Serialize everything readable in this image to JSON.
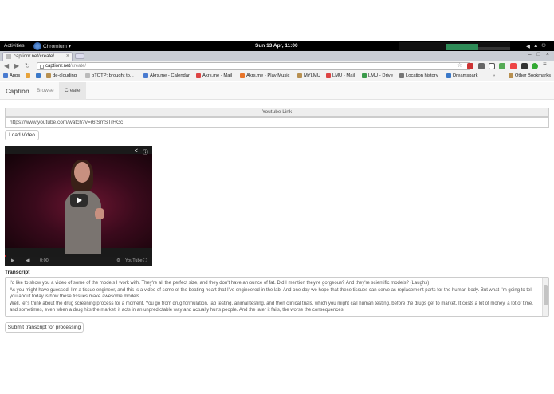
{
  "gnome": {
    "activities": "Activities",
    "app_name": "Chromium ▾",
    "clock": "Sun 13 Apr, 11:00",
    "tray_icons": [
      "volume-icon",
      "network-icon",
      "power-icon"
    ]
  },
  "browser": {
    "tab_title": "captionr.net/create/",
    "url_host": "captionr.net",
    "url_path": "/create/",
    "bookmarks": [
      {
        "label": "Apps",
        "icon": "apps-grid-icon",
        "color": "#4a7bd0"
      },
      {
        "label": "",
        "icon": "bookmark-icon",
        "color": "#e8a33a"
      },
      {
        "label": "",
        "icon": "diamond-icon",
        "color": "#3a78c8"
      },
      {
        "label": "de-clouding",
        "icon": "folder-icon",
        "color": "#b89050"
      },
      {
        "label": "pTOTP: brought to...",
        "icon": "page-icon",
        "color": "#bbbbbb"
      },
      {
        "label": "Akrs.me - Calendar",
        "icon": "calendar-icon",
        "color": "#4a7bd0"
      },
      {
        "label": "Akrs.me - Mail",
        "icon": "mail-icon",
        "color": "#d44"
      },
      {
        "label": "Akrs.me - Play Music",
        "icon": "play-music-icon",
        "color": "#e8752a"
      },
      {
        "label": "MYLMU",
        "icon": "folder-icon",
        "color": "#b89050"
      },
      {
        "label": "LMU - Mail",
        "icon": "gmail-icon",
        "color": "#d44"
      },
      {
        "label": "LMU - Drive",
        "icon": "drive-icon",
        "color": "#3a9a4a"
      },
      {
        "label": "Location history",
        "icon": "location-icon",
        "color": "#777"
      },
      {
        "label": "Dreamspark",
        "icon": "dreamspark-icon",
        "color": "#3a78c8"
      }
    ],
    "other_bookmarks": "Other Bookmarks"
  },
  "navbar": {
    "brand": "Caption",
    "links": [
      "Browse",
      "Create"
    ],
    "active": "Create"
  },
  "form": {
    "youtube_label": "Youtube Link",
    "youtube_value": "https://www.youtube.com/watch?v=r6tSmSTrHGc",
    "load_button": "Load Video"
  },
  "video": {
    "time": "0:00",
    "progress_fraction": 0.0,
    "logo": "YouTube"
  },
  "transcript": {
    "label": "Transcript",
    "lines": [
      "I'd like to show you a video of some of the models I work with. They're all the perfect size, and they don't have an ounce of fat. Did I mention they're gorgeous? And they're scientific models? (Laughs)",
      "As you might have guessed, I'm a tissue engineer, and this is a video of some of the beating heart that I've engineered in the lab. And one day we hope that these tissues can serve as replacement parts for the human body. But what I'm going to tell you about today is how these tissues make awesome models.",
      "Well, let's think about the drug screening process for a moment. You go from drug formulation, lab testing, animal testing, and then clinical trials, which you might call human testing, before the drugs get to market. It costs a lot of money, a lot of time, and sometimes, even when a drug hits the market, it acts in an unpredictable way and actually hurts people. And the later it fails, the worse the consequences."
    ],
    "submit_button": "Submit transcript for processing"
  }
}
